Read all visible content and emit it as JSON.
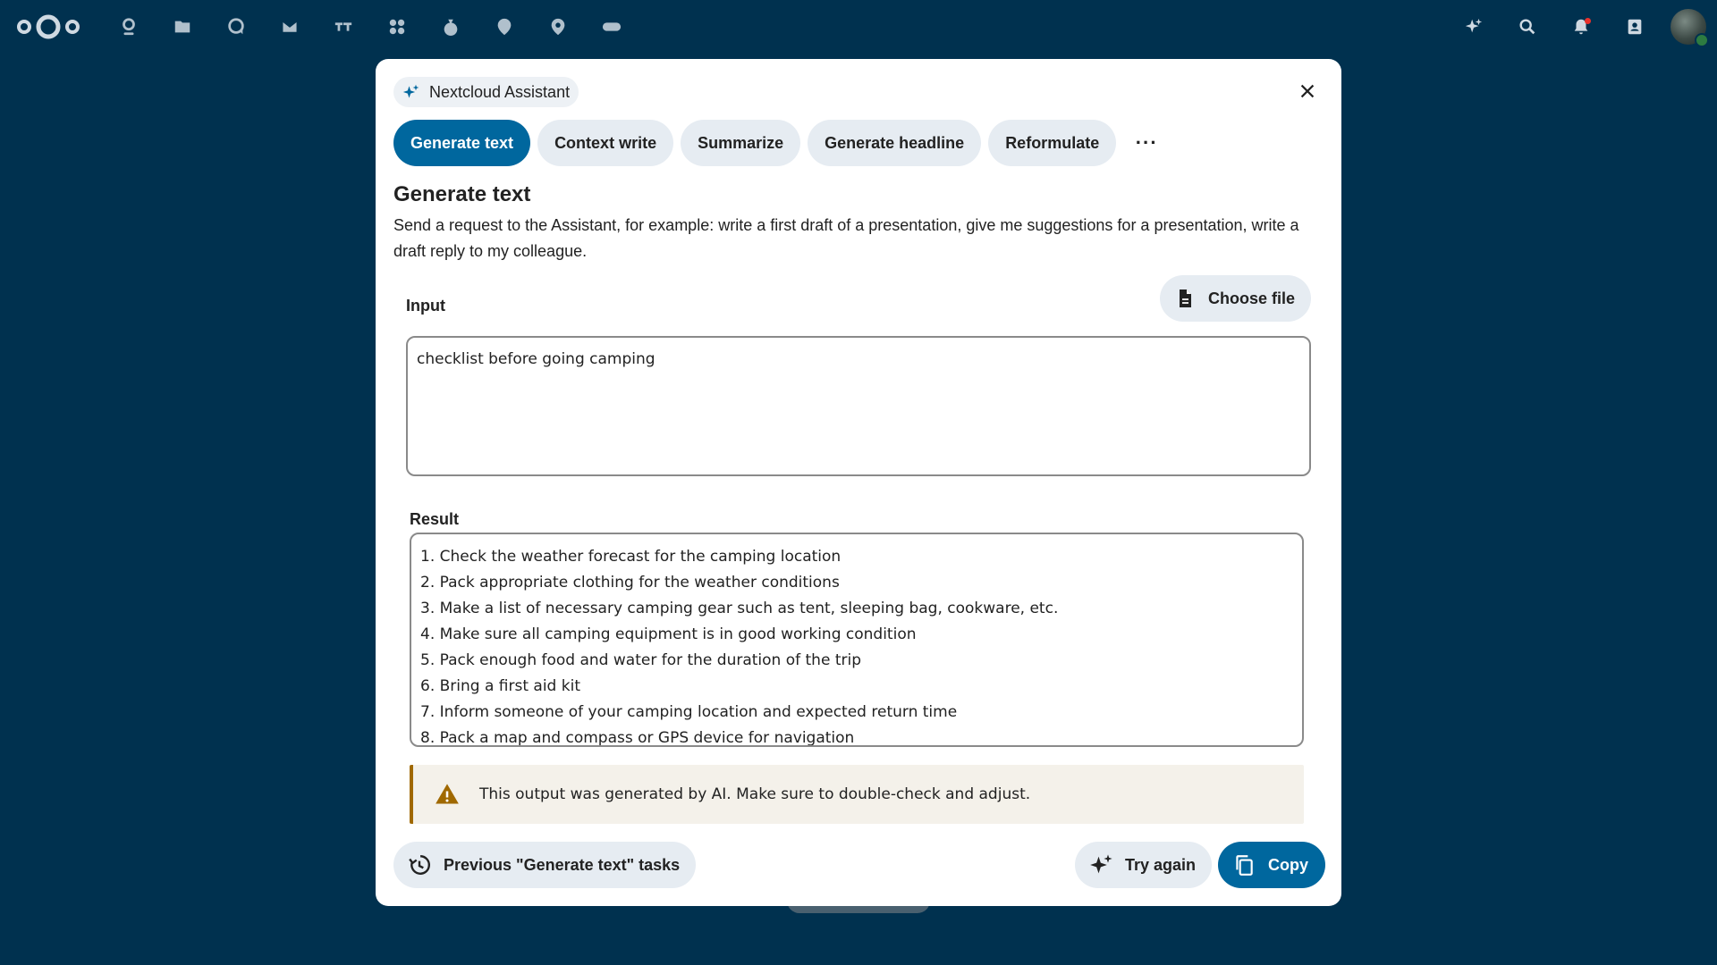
{
  "topbar": {
    "apps": [
      {
        "icon": "dashboard-icon",
        "name": "Dashboard"
      },
      {
        "icon": "files-icon",
        "name": "Files"
      },
      {
        "icon": "talk-icon",
        "name": "Talk"
      },
      {
        "icon": "mail-icon",
        "name": "Mail"
      },
      {
        "icon": "deck-icon",
        "name": "Deck"
      },
      {
        "icon": "apps-icon",
        "name": "Apps"
      },
      {
        "icon": "cospend-icon",
        "name": "Cospend"
      },
      {
        "icon": "maps-icon",
        "name": "Maps"
      },
      {
        "icon": "location-icon",
        "name": "Location"
      },
      {
        "icon": "ocs-icon",
        "name": "OCS"
      }
    ],
    "right": [
      "assistant-icon",
      "search-icon",
      "notifications-icon",
      "contacts-icon"
    ]
  },
  "modal": {
    "chip_label": "Nextcloud Assistant",
    "tabs": [
      {
        "label": "Generate text",
        "active": true
      },
      {
        "label": "Context write",
        "active": false
      },
      {
        "label": "Summarize",
        "active": false
      },
      {
        "label": "Generate headline",
        "active": false
      },
      {
        "label": "Reformulate",
        "active": false
      }
    ],
    "more_label": "···",
    "task_title": "Generate text",
    "task_description": "Send a request to the Assistant, for example: write a first draft of a presentation, give me suggestions for a presentation, write a draft reply to my colleague.",
    "input_label": "Input",
    "choose_file_label": "Choose file",
    "input_value": "checklist before going camping",
    "result_label": "Result",
    "result_lines": [
      "1. Check the weather forecast for the camping location",
      "2. Pack appropriate clothing for the weather conditions",
      "3. Make a list of necessary camping gear such as tent, sleeping bag, cookware, etc.",
      "4. Make sure all camping equipment is in good working condition",
      "5. Pack enough food and water for the duration of the trip",
      "6. Bring a first aid kit",
      "7. Inform someone of your camping location and expected return time",
      "8. Pack a map and compass or GPS device for navigation"
    ],
    "warning_text": "This output was generated by AI. Make sure to double-check and adjust.",
    "prev_tasks_label": "Previous \"Generate text\" tasks",
    "try_again_label": "Try again",
    "copy_label": "Copy"
  },
  "colors": {
    "background": "#00314f",
    "primary": "#00679e",
    "button_bg": "#e6ecf2",
    "warning_border": "#a06900",
    "warning_bg": "#f4f1ea"
  }
}
